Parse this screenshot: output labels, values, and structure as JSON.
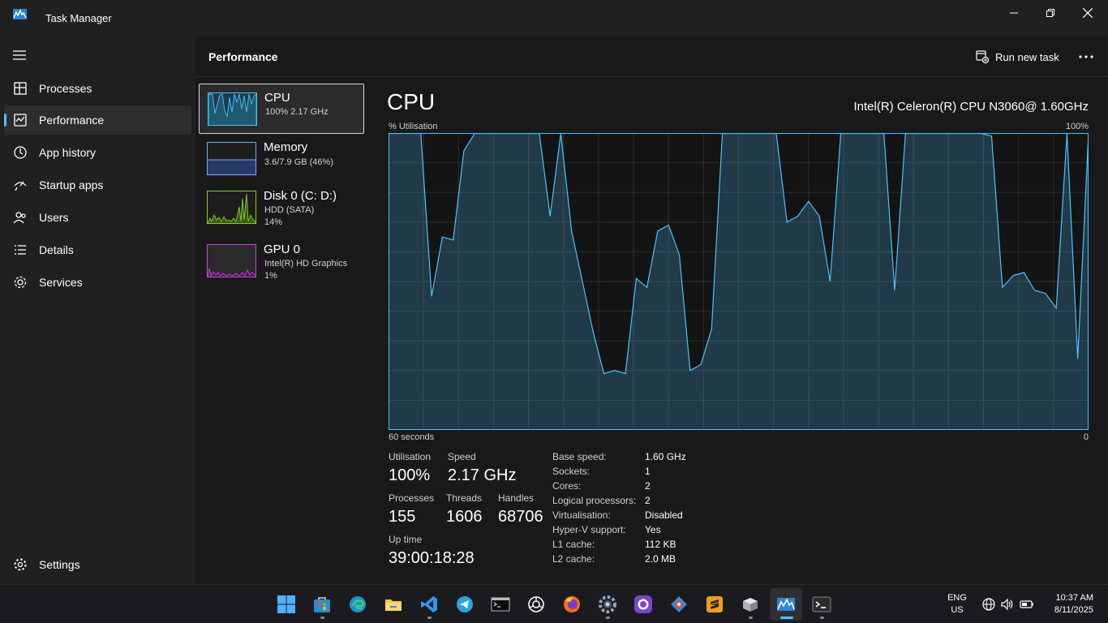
{
  "window": {
    "title": "Task Manager"
  },
  "sidebar": {
    "items": [
      {
        "label": "Processes",
        "icon": "processes-icon"
      },
      {
        "label": "Performance",
        "icon": "performance-icon",
        "active": true
      },
      {
        "label": "App history",
        "icon": "app-history-icon"
      },
      {
        "label": "Startup apps",
        "icon": "startup-apps-icon"
      },
      {
        "label": "Users",
        "icon": "users-icon"
      },
      {
        "label": "Details",
        "icon": "details-icon"
      },
      {
        "label": "Services",
        "icon": "services-icon"
      }
    ],
    "settings_label": "Settings"
  },
  "header": {
    "title": "Performance",
    "run_new_task": "Run new task"
  },
  "resources": [
    {
      "name": "CPU",
      "sub1": "100%  2.17 GHz",
      "sub2": "",
      "color": "#4cc2ff"
    },
    {
      "name": "Memory",
      "sub1": "3.6/7.9 GB (46%)",
      "sub2": "",
      "color": "#7ba7ff"
    },
    {
      "name": "Disk 0 (C: D:)",
      "sub1": "HDD (SATA)",
      "sub2": "14%",
      "color": "#86cc2c"
    },
    {
      "name": "GPU 0",
      "sub1": "Intel(R) HD Graphics",
      "sub2": "1%",
      "color": "#c44ad8"
    }
  ],
  "detail": {
    "title": "CPU",
    "model": "Intel(R) Celeron(R) CPU N3060@ 1.60GHz",
    "y_label": "% Utilisation",
    "y_max_label": "100%",
    "x_left_label": "60 seconds",
    "x_right_label": "0"
  },
  "chart_data": {
    "type": "area",
    "y_unit": "%",
    "ylim": [
      0,
      100
    ],
    "x_span_seconds": 60,
    "points_oldest_to_newest": [
      100,
      100,
      100,
      100,
      45,
      65,
      64,
      94,
      100,
      100,
      100,
      100,
      100,
      100,
      100,
      72,
      100,
      67,
      50,
      33,
      19,
      20,
      19,
      51,
      48,
      67,
      69,
      59,
      20,
      22,
      34,
      100,
      100,
      100,
      100,
      100,
      100,
      70,
      72,
      77,
      72,
      50,
      100,
      100,
      100,
      100,
      100,
      47,
      100,
      100,
      100,
      100,
      100,
      100,
      100,
      100,
      99,
      48,
      52,
      53,
      47,
      46,
      41,
      100,
      24,
      100
    ],
    "grid": true,
    "color": "#4cc2ff"
  },
  "stats": {
    "utilisation": {
      "label": "Utilisation",
      "value": "100%"
    },
    "speed": {
      "label": "Speed",
      "value": "2.17 GHz"
    },
    "processes": {
      "label": "Processes",
      "value": "155"
    },
    "threads": {
      "label": "Threads",
      "value": "1606"
    },
    "handles": {
      "label": "Handles",
      "value": "68706"
    },
    "uptime": {
      "label": "Up time",
      "value": "39:00:18:28"
    }
  },
  "specs": [
    {
      "key": "Base speed:",
      "value": "1.60 GHz"
    },
    {
      "key": "Sockets:",
      "value": "1"
    },
    {
      "key": "Cores:",
      "value": "2"
    },
    {
      "key": "Logical processors:",
      "value": "2"
    },
    {
      "key": "Virtualisation:",
      "value": "Disabled"
    },
    {
      "key": "Hyper-V support:",
      "value": "Yes"
    },
    {
      "key": "L1 cache:",
      "value": "112 KB"
    },
    {
      "key": "L2 cache:",
      "value": "2.0 MB"
    }
  ],
  "taskbar": {
    "apps": [
      "start-icon",
      "store-icon",
      "edge-icon",
      "file-explorer-icon",
      "vscode-icon",
      "telegram-icon",
      "terminal-cmd-icon",
      "chatgpt-icon",
      "firefox-icon",
      "settings-app-icon",
      "github-icon",
      "git-icon",
      "sublime-icon",
      "package-icon",
      "task-manager-icon",
      "windows-terminal-icon"
    ],
    "lang_line1": "ENG",
    "lang_line2": "US",
    "time": "10:37 AM",
    "date": "8/11/2025"
  }
}
